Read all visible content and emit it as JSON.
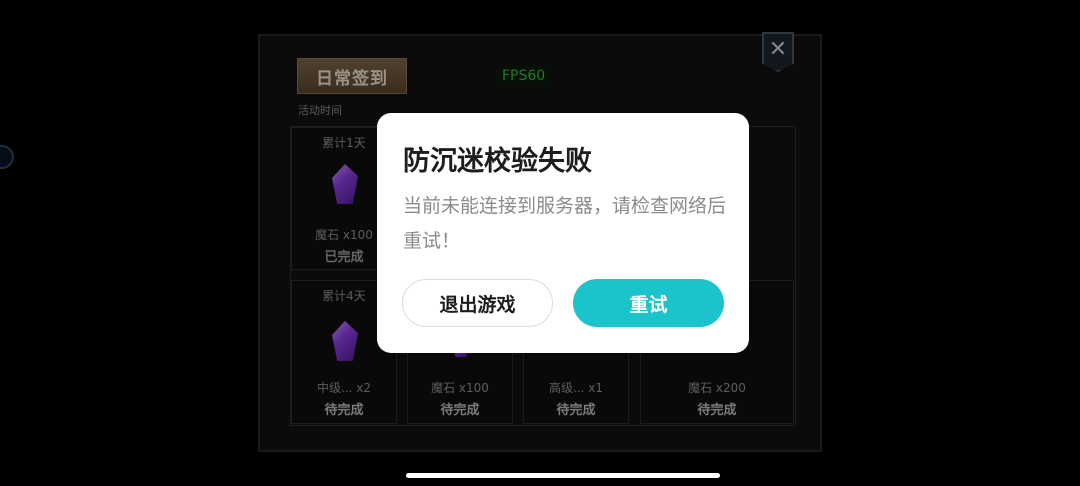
{
  "panel": {
    "title": "日常签到",
    "fps": "FPS60",
    "activity_time_label": "活动时间",
    "close_icon": "close-icon"
  },
  "rewards": [
    {
      "day": "累计1天",
      "item": "魔石 x100",
      "status": "已完成",
      "icon": "gem-icon"
    },
    {
      "day": "累计4天",
      "item": "中级... x2",
      "status": "待完成",
      "icon": "gem-icon"
    },
    {
      "day": "",
      "item": "魔石 x100",
      "status": "待完成",
      "icon": "gem-icon"
    },
    {
      "day": "",
      "item": "高级... x1",
      "status": "待完成",
      "icon": "gem-icon"
    },
    {
      "day": "",
      "item": "魔石 x200",
      "status": "待完成",
      "icon": "gem-icon"
    }
  ],
  "dialog": {
    "title": "防沉迷校验失败",
    "message": "当前未能连接到服务器，请检查网络后重试！",
    "exit_label": "退出游戏",
    "retry_label": "重试",
    "accent_color": "#1dc3cb"
  }
}
